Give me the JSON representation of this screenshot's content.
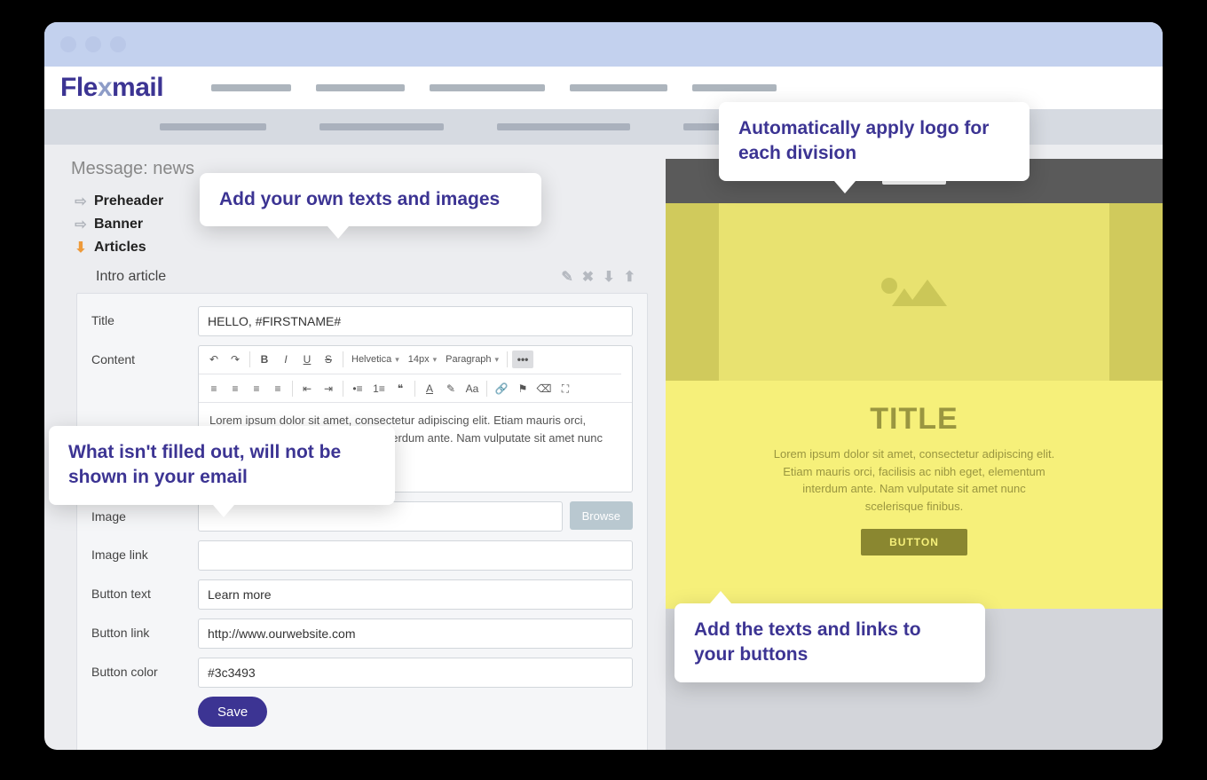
{
  "brand": {
    "name_pre": "Fle",
    "name_x": "x",
    "name_post": "mail"
  },
  "message": {
    "title_prefix": "Message: news"
  },
  "sidebar": {
    "items": [
      {
        "label": "Preheader",
        "active": false
      },
      {
        "label": "Banner",
        "active": false
      },
      {
        "label": "Articles",
        "active": true
      }
    ]
  },
  "section": {
    "name": "Intro article"
  },
  "form": {
    "labels": {
      "title": "Title",
      "content": "Content",
      "image": "Image",
      "image_link": "Image link",
      "button_text": "Button text",
      "button_link": "Button link",
      "button_color": "Button color"
    },
    "values": {
      "title": "HELLO, #FIRSTNAME#",
      "content": "Lorem ipsum dolor sit amet, consectetur adipiscing elit. Etiam mauris orci, facilisis ac nibh eget, elementum interdum ante. Nam vulputate sit amet nunc scelerisque finibus.",
      "image": "",
      "image_link": "",
      "button_text": "Learn more",
      "button_link": "http://www.ourwebsite.com",
      "button_color": "#3c3493"
    },
    "browse_label": "Browse",
    "save_label": "Save"
  },
  "rte": {
    "font": "Helvetica",
    "size": "14px",
    "block": "Paragraph"
  },
  "preview": {
    "title": "TITLE",
    "body": "Lorem ipsum dolor sit amet, consectetur adipiscing elit. Etiam mauris orci, facilisis ac nibh eget, elementum interdum ante. Nam vulputate sit amet nunc scelerisque finibus.",
    "button": "BUTTON"
  },
  "callouts": {
    "c1": "Add your own texts and images",
    "c2": "What isn't filled out, will not be shown in your email",
    "c3": "Automatically apply logo for each division",
    "c4": "Add the texts and links to your buttons"
  }
}
